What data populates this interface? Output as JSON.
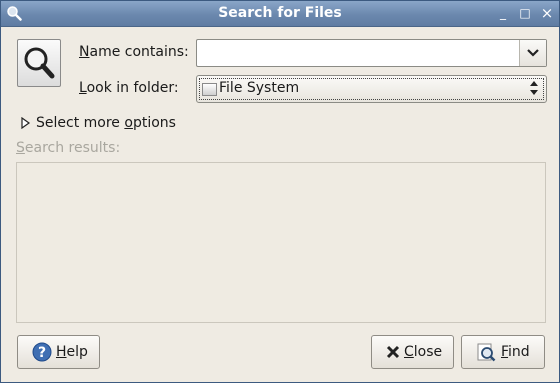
{
  "window": {
    "title": "Search for Files"
  },
  "titlebar": {
    "minimize_glyph": "_",
    "maximize_glyph": "□",
    "close_glyph": "×"
  },
  "form": {
    "name_label_first": "N",
    "name_label_rest": "ame contains:",
    "name_value": "",
    "folder_label_first": "L",
    "folder_label_rest": "ook in folder:",
    "folder_value": "File System"
  },
  "expander": {
    "label_a": "Select more ",
    "label_u": "o",
    "label_b": "ptions"
  },
  "results": {
    "label_first": "S",
    "label_rest": "earch results:"
  },
  "buttons": {
    "help_first": "H",
    "help_rest": "elp",
    "close_first": "C",
    "close_rest": "lose",
    "find_first": "F",
    "find_rest": "ind"
  },
  "icons": {
    "title": "magnifier-icon",
    "main": "search-document-icon",
    "disk": "harddisk-icon",
    "help": "help-icon",
    "close": "close-x-icon",
    "find": "find-icon"
  }
}
